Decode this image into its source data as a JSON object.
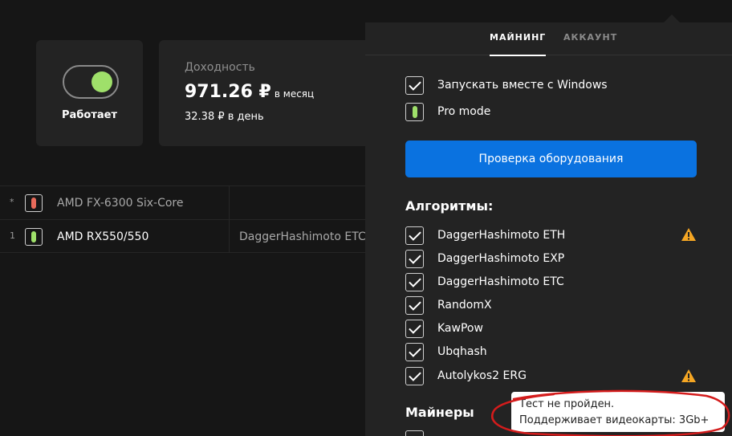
{
  "status": {
    "label": "Работает"
  },
  "income": {
    "title": "Доходность",
    "monthly_value": "971.26 ₽",
    "monthly_unit": "в месяц",
    "daily": "32.38 ₽ в день"
  },
  "devices": [
    {
      "num": "*",
      "name": "AMD FX-6300 Six-Core",
      "algo": "",
      "indicator_color": "#e86a5a",
      "name_color": "#a8a8a8"
    },
    {
      "num": "1",
      "name": "AMD RX550/550",
      "algo": "DaggerHashimoto ETC",
      "indicator_color": "#9fe06a",
      "name_color": "#ffffff"
    }
  ],
  "settings": {
    "tabs": [
      "МАЙНИНГ",
      "АККАУНТ"
    ],
    "start_with_windows": "Запускать вместе с Windows",
    "pro_mode": "Pro mode",
    "check_button": "Проверка оборудования",
    "algorithms_title": "Алгоритмы:",
    "algorithms": [
      {
        "name": "DaggerHashimoto ETH",
        "checked": true,
        "warning": true
      },
      {
        "name": "DaggerHashimoto EXP",
        "checked": true,
        "warning": false
      },
      {
        "name": "DaggerHashimoto ETC",
        "checked": true,
        "warning": false
      },
      {
        "name": "RandomX",
        "checked": true,
        "warning": false
      },
      {
        "name": "KawPow",
        "checked": true,
        "warning": false
      },
      {
        "name": "Ubqhash",
        "checked": true,
        "warning": false
      },
      {
        "name": "Autolykos2 ERG",
        "checked": true,
        "warning": true
      }
    ],
    "miners_title": "Майнеры"
  },
  "tooltip": {
    "line1": "Тест не пройден.",
    "line2": "Поддерживает видеокарты: 3Gb+"
  },
  "colors": {
    "accent": "#0a72e0",
    "status_on": "#9fe06a",
    "status_error": "#e86a5a",
    "warning": "#f5a623"
  }
}
